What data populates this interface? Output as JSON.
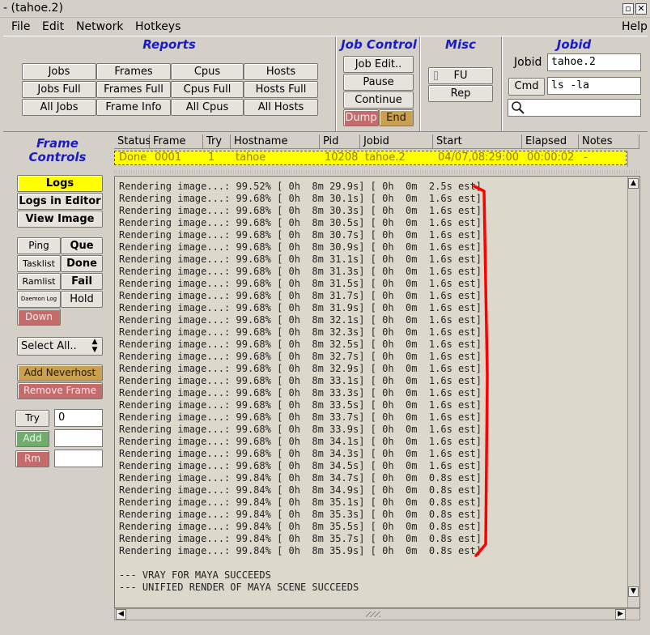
{
  "window": {
    "title": "- (tahoe.2)",
    "help": "Help"
  },
  "menu": [
    "File",
    "Edit",
    "Network",
    "Hotkeys"
  ],
  "reports": {
    "title": "Reports",
    "buttons": [
      "Jobs",
      "Frames",
      "Cpus",
      "Hosts",
      "Jobs Full",
      "Frames Full",
      "Cpus Full",
      "Hosts Full",
      "All Jobs",
      "Frame Info",
      "All Cpus",
      "All Hosts"
    ]
  },
  "job_control": {
    "title": "Job Control",
    "edit": "Job Edit..",
    "pause": "Pause",
    "continue": "Continue",
    "dump": "Dump",
    "end": "End"
  },
  "misc": {
    "title": "Misc",
    "fu": "FU",
    "rep": "Rep"
  },
  "jobid": {
    "title": "Jobid",
    "label": "Jobid",
    "value": "tahoe.2",
    "cmd_label": "Cmd",
    "cmd_value": "ls -la",
    "search_value": ""
  },
  "frame_controls": {
    "title_line1": "Frame",
    "title_line2": "Controls",
    "logs": "Logs",
    "logs_editor": "Logs in Editor",
    "view_image": "View Image",
    "ping": "Ping",
    "que": "Que",
    "tasklist": "Tasklist",
    "done": "Done",
    "ramlist": "Ramlist",
    "fail": "Fail",
    "daemon_log": "Daemon Log",
    "hold": "Hold",
    "down": "Down",
    "select_all": "Select All..",
    "add_neverhost": "Add Neverhost",
    "remove_frame": "Remove Frame",
    "try": "Try",
    "try_value": "0",
    "add": "Add",
    "add_value": "",
    "rm": "Rm",
    "rm_value": ""
  },
  "table": {
    "headers": [
      "Status",
      "Frame",
      "Try",
      "Hostname",
      "Pid",
      "Jobid",
      "Start",
      "Elapsed",
      "Notes"
    ],
    "rows": [
      [
        "Done",
        "0001",
        "1",
        "tahoe",
        "10208",
        "tahoe.2",
        "04/07,08:29:00",
        "00:00:02",
        "-"
      ]
    ]
  },
  "log": {
    "lines": [
      "Rendering image...: 99.52% [ 0h  8m 29.9s] [ 0h  0m  2.5s est]",
      "Rendering image...: 99.68% [ 0h  8m 30.1s] [ 0h  0m  1.6s est]",
      "Rendering image...: 99.68% [ 0h  8m 30.3s] [ 0h  0m  1.6s est]",
      "Rendering image...: 99.68% [ 0h  8m 30.5s] [ 0h  0m  1.6s est]",
      "Rendering image...: 99.68% [ 0h  8m 30.7s] [ 0h  0m  1.6s est]",
      "Rendering image...: 99.68% [ 0h  8m 30.9s] [ 0h  0m  1.6s est]",
      "Rendering image...: 99.68% [ 0h  8m 31.1s] [ 0h  0m  1.6s est]",
      "Rendering image...: 99.68% [ 0h  8m 31.3s] [ 0h  0m  1.6s est]",
      "Rendering image...: 99.68% [ 0h  8m 31.5s] [ 0h  0m  1.6s est]",
      "Rendering image...: 99.68% [ 0h  8m 31.7s] [ 0h  0m  1.6s est]",
      "Rendering image...: 99.68% [ 0h  8m 31.9s] [ 0h  0m  1.6s est]",
      "Rendering image...: 99.68% [ 0h  8m 32.1s] [ 0h  0m  1.6s est]",
      "Rendering image...: 99.68% [ 0h  8m 32.3s] [ 0h  0m  1.6s est]",
      "Rendering image...: 99.68% [ 0h  8m 32.5s] [ 0h  0m  1.6s est]",
      "Rendering image...: 99.68% [ 0h  8m 32.7s] [ 0h  0m  1.6s est]",
      "Rendering image...: 99.68% [ 0h  8m 32.9s] [ 0h  0m  1.6s est]",
      "Rendering image...: 99.68% [ 0h  8m 33.1s] [ 0h  0m  1.6s est]",
      "Rendering image...: 99.68% [ 0h  8m 33.3s] [ 0h  0m  1.6s est]",
      "Rendering image...: 99.68% [ 0h  8m 33.5s] [ 0h  0m  1.6s est]",
      "Rendering image...: 99.68% [ 0h  8m 33.7s] [ 0h  0m  1.6s est]",
      "Rendering image...: 99.68% [ 0h  8m 33.9s] [ 0h  0m  1.6s est]",
      "Rendering image...: 99.68% [ 0h  8m 34.1s] [ 0h  0m  1.6s est]",
      "Rendering image...: 99.68% [ 0h  8m 34.3s] [ 0h  0m  1.6s est]",
      "Rendering image...: 99.68% [ 0h  8m 34.5s] [ 0h  0m  1.6s est]",
      "Rendering image...: 99.84% [ 0h  8m 34.7s] [ 0h  0m  0.8s est]",
      "Rendering image...: 99.84% [ 0h  8m 34.9s] [ 0h  0m  0.8s est]",
      "Rendering image...: 99.84% [ 0h  8m 35.1s] [ 0h  0m  0.8s est]",
      "Rendering image...: 99.84% [ 0h  8m 35.3s] [ 0h  0m  0.8s est]",
      "Rendering image...: 99.84% [ 0h  8m 35.5s] [ 0h  0m  0.8s est]",
      "Rendering image...: 99.84% [ 0h  8m 35.7s] [ 0h  0m  0.8s est]",
      "Rendering image...: 99.84% [ 0h  8m 35.9s] [ 0h  0m  0.8s est]",
      "",
      "--- VRAY FOR MAYA SUCCEEDS",
      "--- UNIFIED RENDER OF MAYA SCENE SUCCEEDS"
    ]
  },
  "colors": {
    "section_title": "#1a1acc",
    "highlight": "#ffff00",
    "annotation": "#ff0000",
    "red_button": "#c66b6b",
    "tan_button": "#c8a050",
    "green_button": "#6fae6a"
  },
  "icons": {
    "close": "close-icon",
    "minimize": "minimize-icon",
    "search": "search-icon",
    "scroll_up": "scroll-up-icon",
    "scroll_down": "scroll-down-icon",
    "select_arrows": "updown-arrows-icon"
  }
}
